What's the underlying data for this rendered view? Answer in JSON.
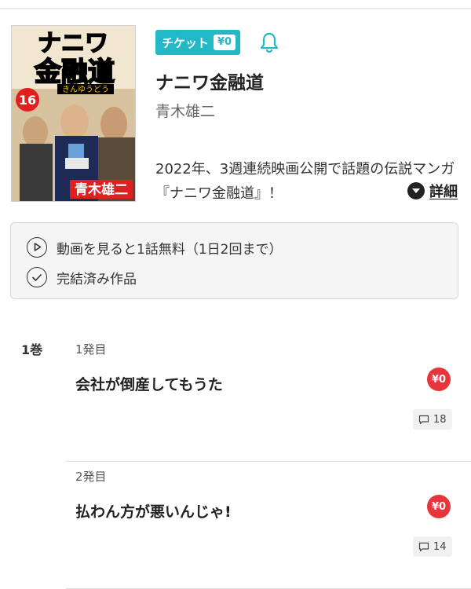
{
  "book": {
    "cover_title": "ナニワ金融道",
    "cover_furigana": "きんゆうどう",
    "cover_volume": "16",
    "cover_author": "青木雄二",
    "ticket_label": "チケット",
    "ticket_price": "¥0",
    "title": "ナニワ金融道",
    "author": "青木雄二",
    "synopsis": "2022年、3週連続映画公開で話題の伝説マンガ『ナニワ金融道』！",
    "detail_label": "詳細"
  },
  "features": [
    {
      "label": "動画を見ると1話無料（1日2回まで）",
      "icon": "play-icon"
    },
    {
      "label": "完結済み作品",
      "icon": "check-circle-icon"
    }
  ],
  "volume_label": "1巻",
  "episodes": [
    {
      "number": "1発目",
      "title": "会社が倒産してもうた",
      "price": "¥0",
      "comments": "18"
    },
    {
      "number": "2発目",
      "title": "払わん方が悪いんじゃ!",
      "price": "¥0",
      "comments": "14"
    }
  ],
  "colors": {
    "ticket": "#22b8c5",
    "price_badge": "#e8343a",
    "cover_title_red": "#e02020"
  }
}
